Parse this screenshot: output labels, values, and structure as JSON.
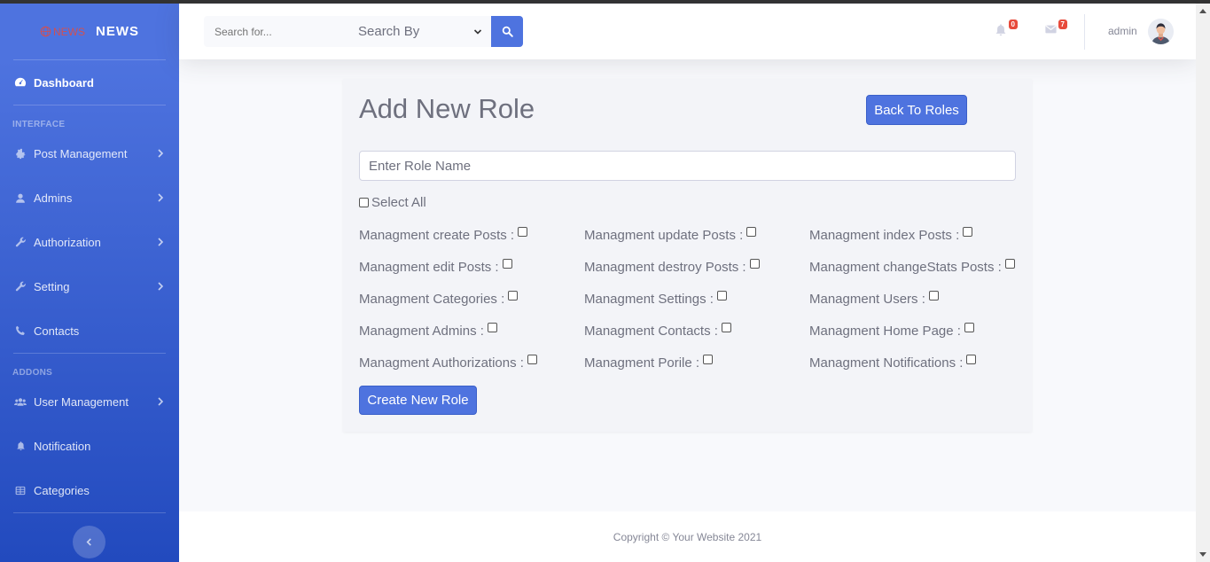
{
  "brand": {
    "logo_text": "NEWS",
    "name": "NEWS"
  },
  "sidebar": {
    "items": [
      {
        "label": "Dashboard"
      },
      {
        "label": "Post Management"
      },
      {
        "label": "Admins"
      },
      {
        "label": "Authorization"
      },
      {
        "label": "Setting"
      },
      {
        "label": "Contacts"
      },
      {
        "label": "User Management"
      },
      {
        "label": "Notification"
      },
      {
        "label": "Categories"
      }
    ],
    "heading_interface": "INTERFACE",
    "heading_addons": "ADDONS"
  },
  "topbar": {
    "search_placeholder": "Search for...",
    "search_by": "Search By",
    "notifications_count": "0",
    "messages_count": "7",
    "username": "admin"
  },
  "card": {
    "title": "Add New Role",
    "back_button": "Back To Roles",
    "role_name_placeholder": "Enter Role Name",
    "select_all": "Select All",
    "create_button": "Create New Role",
    "permissions": [
      "Managment create Posts :",
      "Managment update Posts :",
      "Managment index Posts :",
      "Managment edit Posts :",
      "Managment destroy Posts :",
      "Managment changeStats Posts :",
      "Managment Categories :",
      "Managment Settings :",
      "Managment Users :",
      "Managment Admins :",
      "Managment Contacts :",
      "Managment Home Page :",
      "Managment Authorizations :",
      "Managment Porile :",
      "Managment Notifications :"
    ]
  },
  "footer": {
    "copyright": "Copyright © Your Website 2021"
  },
  "colors": {
    "primary": "#4e73df",
    "sidebar_dark": "#224abe",
    "danger": "#e74a3b",
    "text_muted": "#858796"
  }
}
